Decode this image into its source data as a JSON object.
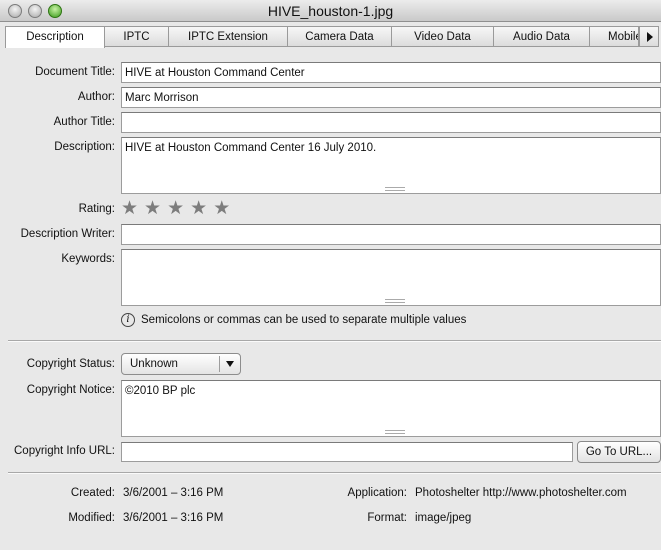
{
  "window": {
    "title": "HIVE_houston-1.jpg"
  },
  "tabs": [
    {
      "label": "Description",
      "active": true
    },
    {
      "label": "IPTC"
    },
    {
      "label": "IPTC Extension"
    },
    {
      "label": "Camera Data"
    },
    {
      "label": "Video Data"
    },
    {
      "label": "Audio Data"
    },
    {
      "label": "Mobile"
    }
  ],
  "fields": {
    "document_title": {
      "label": "Document Title:",
      "value": "HIVE at Houston Command Center"
    },
    "author": {
      "label": "Author:",
      "value": "Marc Morrison"
    },
    "author_title": {
      "label": "Author Title:",
      "value": ""
    },
    "description": {
      "label": "Description:",
      "value": "HIVE at Houston Command Center 16 July 2010."
    },
    "rating": {
      "label": "Rating:",
      "stars": 0,
      "max": 5
    },
    "description_writer": {
      "label": "Description Writer:",
      "value": ""
    },
    "keywords": {
      "label": "Keywords:",
      "value": ""
    }
  },
  "hint": {
    "text": "Semicolons or commas can be used to separate multiple values",
    "icon": "info-icon"
  },
  "copyright": {
    "status_label": "Copyright Status:",
    "status_value": "Unknown",
    "notice_label": "Copyright Notice:",
    "notice_value": "©2010 BP plc",
    "url_label": "Copyright Info URL:",
    "url_value": "",
    "go_button": "Go To URL..."
  },
  "meta": {
    "created_label": "Created:",
    "created_value": "3/6/2001 – 3:16 PM",
    "modified_label": "Modified:",
    "modified_value": "3/6/2001 – 3:16 PM",
    "application_label": "Application:",
    "application_value": "Photoshelter http://www.photoshelter.com",
    "format_label": "Format:",
    "format_value": "image/jpeg"
  },
  "colors": {
    "star": "#7d7d7d",
    "window_bg": "#e8e8e8",
    "field_bg": "#ffffff"
  }
}
